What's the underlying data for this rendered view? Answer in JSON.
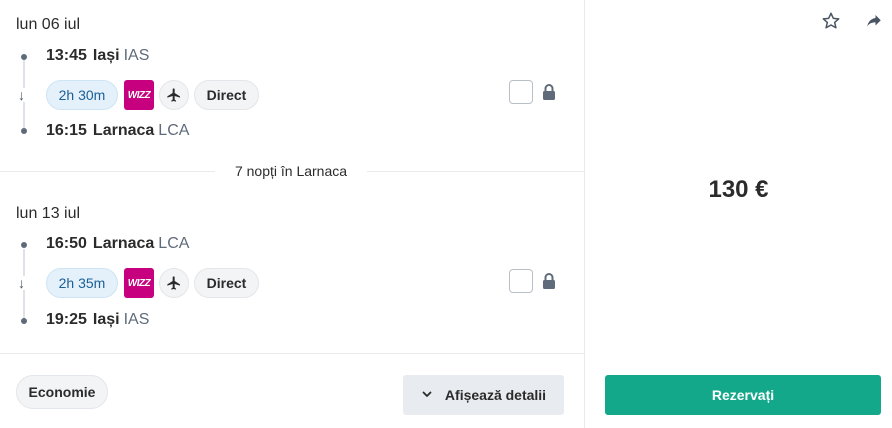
{
  "outbound": {
    "date": "lun 06 iul",
    "depart": {
      "time": "13:45",
      "city": "Iași",
      "code": "IAS"
    },
    "arrive": {
      "time": "16:15",
      "city": "Larnaca",
      "code": "LCA"
    },
    "duration": "2h 30m",
    "airline_logo_text": "WIZZ",
    "stops": "Direct"
  },
  "stay": {
    "label": "7 nopți în Larnaca"
  },
  "inbound": {
    "date": "lun 13 iul",
    "depart": {
      "time": "16:50",
      "city": "Larnaca",
      "code": "LCA"
    },
    "arrive": {
      "time": "19:25",
      "city": "Iași",
      "code": "IAS"
    },
    "duration": "2h 35m",
    "airline_logo_text": "WIZZ",
    "stops": "Direct"
  },
  "footer": {
    "cabin": "Economie",
    "details_label": "Afișează detalii"
  },
  "booking": {
    "price": "130 €",
    "book_label": "Rezervați"
  },
  "icons": {
    "favorite": "star-outline-icon",
    "share": "share-arrow-icon",
    "plane": "plane-icon",
    "lock": "lock-icon",
    "chevron": "chevron-down-icon",
    "arrow": "arrow-down-icon"
  },
  "colors": {
    "accent": "#13a88a",
    "wizz": "#c6007e",
    "duration_bg": "#e4f1fb"
  }
}
